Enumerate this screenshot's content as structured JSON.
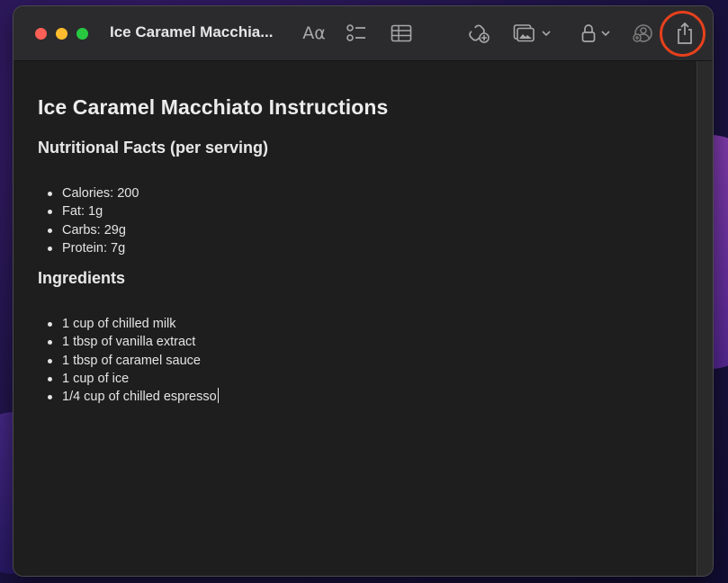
{
  "window": {
    "title": "Ice Caramel Macchia...",
    "format_label": "Aα"
  },
  "toolbar": {
    "icons": [
      "format-text-icon",
      "checklist-icon",
      "table-icon",
      "collaborate-icon",
      "media-icon",
      "lock-icon",
      "share-collab-icon",
      "share-icon"
    ],
    "highlight_color": "#e8401c"
  },
  "note": {
    "title": "Ice Caramel Macchiato Instructions",
    "sections": [
      {
        "heading": "Nutritional Facts (per serving)",
        "items": [
          "Calories: 200",
          "Fat: 1g",
          "Carbs: 29g",
          "Protein: 7g"
        ]
      },
      {
        "heading": "Ingredients",
        "items": [
          "1 cup of chilled milk",
          "1 tbsp of vanilla extract",
          "1 tbsp of caramel sauce",
          "1 cup of ice",
          "1/4 cup of chilled espresso"
        ]
      }
    ]
  }
}
